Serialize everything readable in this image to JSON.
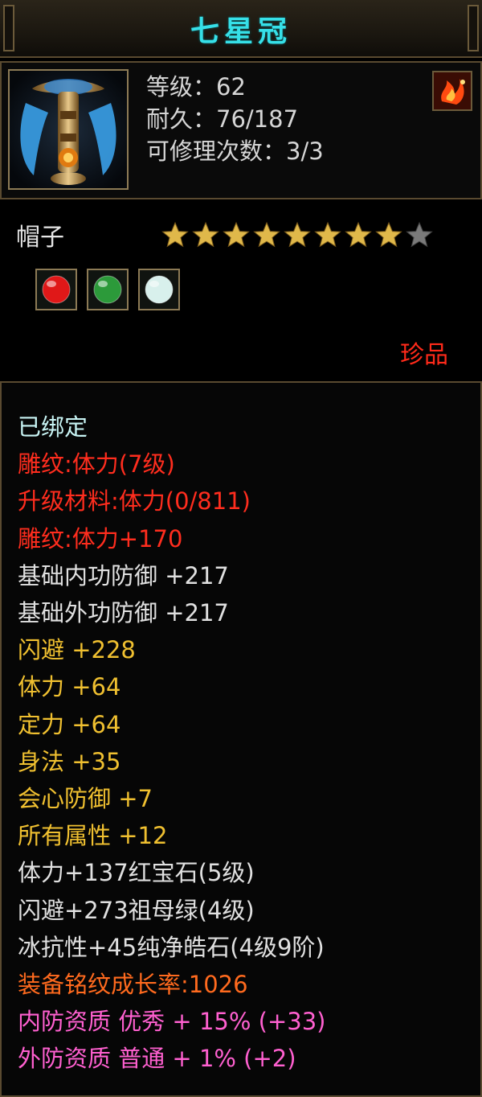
{
  "item": {
    "name": "七星冠",
    "level_text": "等级：62",
    "durability_text": "耐久：76/187",
    "repair_text": "可修理次数：3/3",
    "type": "帽子",
    "stars_filled": 8,
    "stars_total": 9,
    "quality": "珍品",
    "icon": "crown-icon",
    "badge_icon": "flame-badge-icon"
  },
  "gems": [
    {
      "name": "ruby-gem-icon",
      "color": "#e01818"
    },
    {
      "name": "emerald-gem-icon",
      "color": "#2c9a3a"
    },
    {
      "name": "diamond-gem-icon",
      "color": "#d8f0ec"
    }
  ],
  "colors": {
    "title": "#36e0e8",
    "cyan": "#c8f4f4",
    "red": "#ff2d1e",
    "white": "#e0e0e0",
    "yellow": "#f0c030",
    "orange": "#ff6a1e",
    "pink": "#ff60d0",
    "star_gold": "#e0b84a",
    "star_grey": "#7a7a7a"
  },
  "details": [
    {
      "text": "已绑定",
      "color": "cyan"
    },
    {
      "text": "雕纹:体力(7级)",
      "color": "red"
    },
    {
      "text": "升级材料:体力(0/811)",
      "color": "red"
    },
    {
      "text": "雕纹:体力+170",
      "color": "red"
    },
    {
      "text": "基础内功防御 +217",
      "color": "white"
    },
    {
      "text": "基础外功防御 +217",
      "color": "white"
    },
    {
      "text": "闪避 +228",
      "color": "yellow"
    },
    {
      "text": "体力 +64",
      "color": "yellow"
    },
    {
      "text": "定力 +64",
      "color": "yellow"
    },
    {
      "text": "身法 +35",
      "color": "yellow"
    },
    {
      "text": "会心防御 +7",
      "color": "yellow"
    },
    {
      "text": "所有属性 +12",
      "color": "yellow"
    },
    {
      "text": "体力+137红宝石(5级)",
      "color": "white"
    },
    {
      "text": "闪避+273祖母绿(4级)",
      "color": "white"
    },
    {
      "text": "冰抗性+45纯净皓石(4级9阶)",
      "color": "white"
    },
    {
      "text": "装备铭纹成长率:1026",
      "color": "orange"
    },
    {
      "text": "内防资质 优秀 + 15% (+33)",
      "color": "pink"
    },
    {
      "text": "外防资质 普通 + 1% (+2)",
      "color": "pink"
    }
  ]
}
